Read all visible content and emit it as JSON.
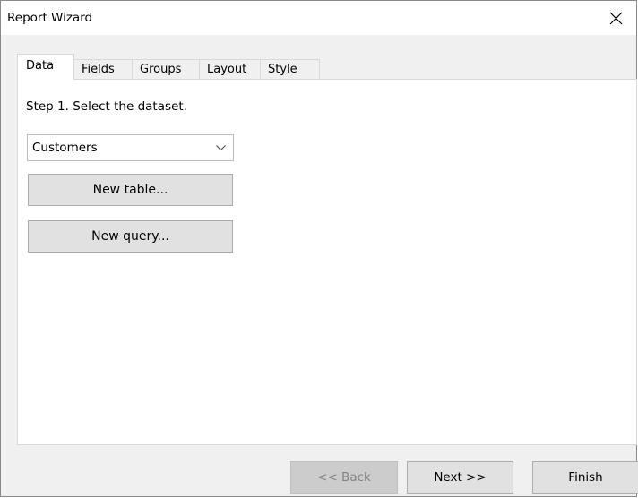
{
  "window": {
    "title": "Report Wizard"
  },
  "tabs": [
    {
      "label": "Data",
      "active": true
    },
    {
      "label": "Fields",
      "active": false
    },
    {
      "label": "Groups",
      "active": false
    },
    {
      "label": "Layout",
      "active": false
    },
    {
      "label": "Style",
      "active": false
    }
  ],
  "data_tab": {
    "step_text": "Step 1. Select the dataset.",
    "dataset_select": {
      "value": "Customers"
    },
    "new_table_label": "New table...",
    "new_query_label": "New query..."
  },
  "footer": {
    "back_label": "<< Back",
    "back_enabled": false,
    "next_label": "Next >>",
    "finish_label": "Finish"
  },
  "icons": {
    "close": "close-icon",
    "dropdown": "chevron-down-icon"
  },
  "colors": {
    "window_bg": "#f0f0f0",
    "button_bg": "#e1e1e1",
    "disabled_button_bg": "#cccccc",
    "disabled_text": "#838383"
  }
}
